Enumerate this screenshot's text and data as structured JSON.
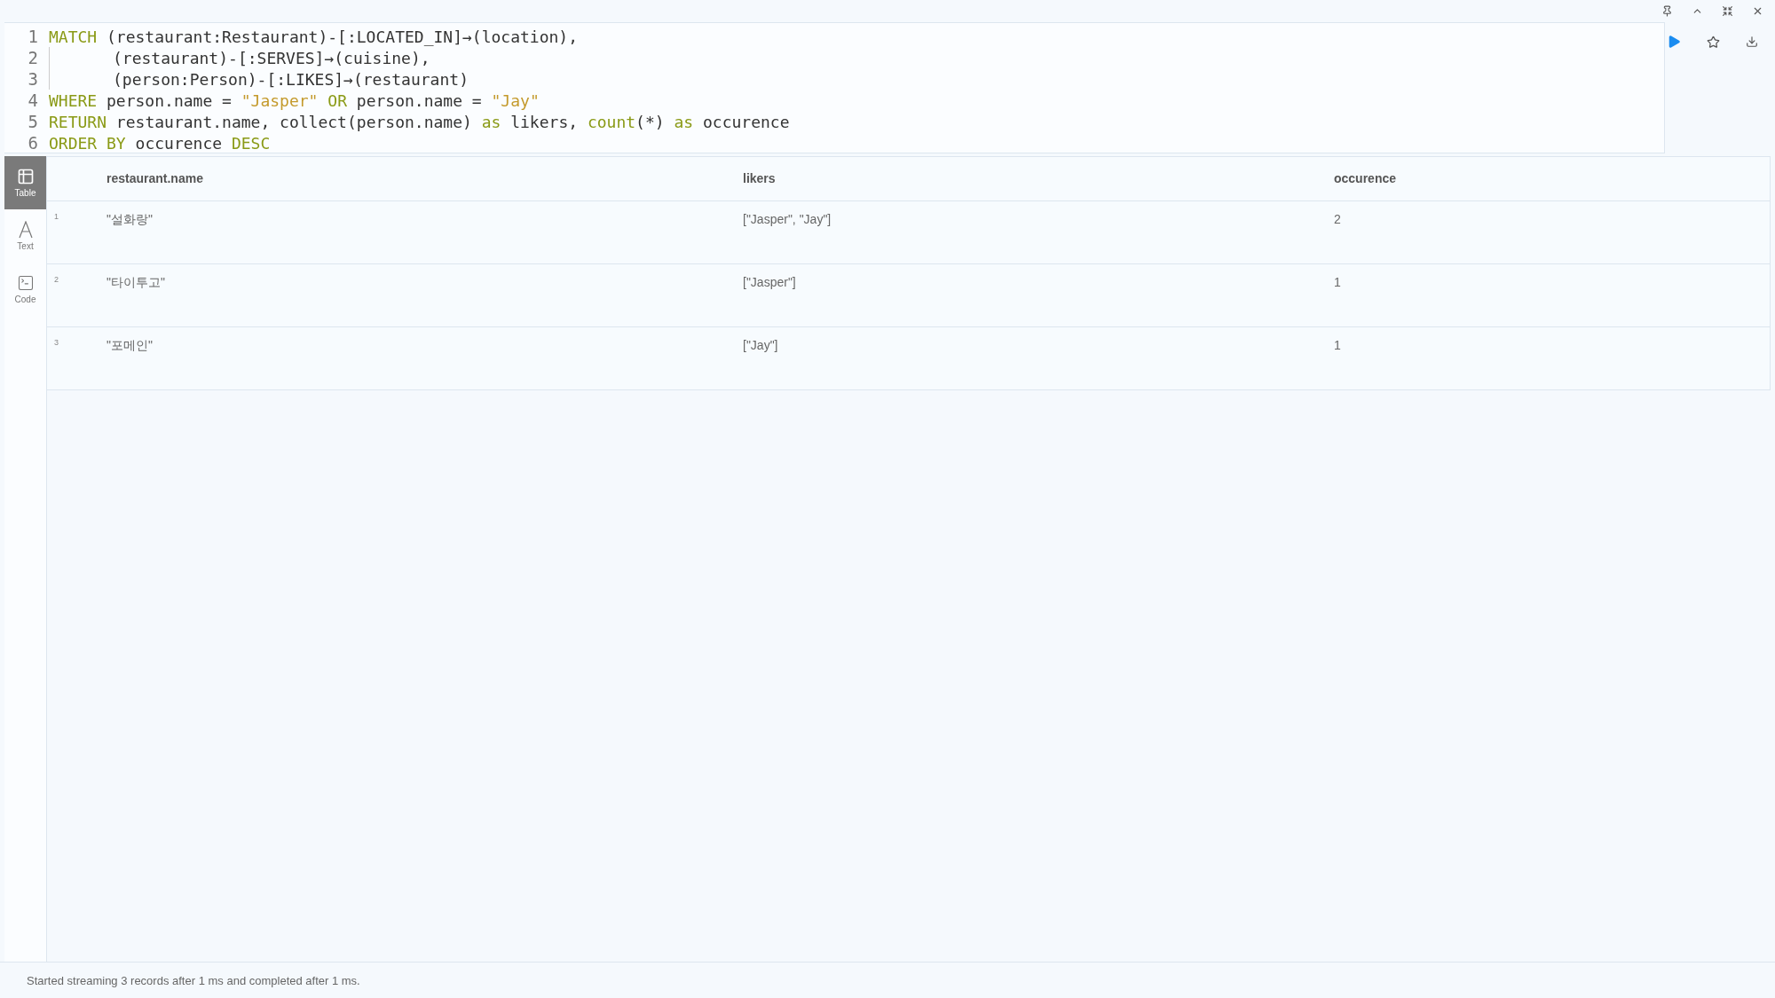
{
  "frame_controls": [
    {
      "kind": "pin"
    },
    {
      "kind": "up"
    },
    {
      "kind": "shrink"
    },
    {
      "kind": "close"
    }
  ],
  "editor": {
    "lines": [
      {
        "number": "1",
        "continuation": false,
        "tokens": [
          {
            "kind": "keyword",
            "text": "MATCH"
          },
          {
            "kind": "plain",
            "text": " (restaurant:Restaurant)-[:LOCATED_IN]→(location),"
          }
        ]
      },
      {
        "number": "2",
        "continuation": true,
        "tokens": [
          {
            "kind": "plain",
            "text": "(restaurant)-[:SERVES]→(cuisine),"
          }
        ]
      },
      {
        "number": "3",
        "continuation": true,
        "tokens": [
          {
            "kind": "plain",
            "text": "(person:Person)-[:LIKES]→(restaurant)"
          }
        ]
      },
      {
        "number": "4",
        "continuation": false,
        "tokens": [
          {
            "kind": "keyword",
            "text": "WHERE"
          },
          {
            "kind": "plain",
            "text": " person.name = "
          },
          {
            "kind": "string",
            "text": "\"Jasper\""
          },
          {
            "kind": "keyword",
            "text": " OR"
          },
          {
            "kind": "plain",
            "text": " person.name = "
          },
          {
            "kind": "string",
            "text": "\"Jay\""
          }
        ]
      },
      {
        "number": "5",
        "continuation": false,
        "tokens": [
          {
            "kind": "keyword",
            "text": "RETURN"
          },
          {
            "kind": "plain",
            "text": " restaurant.name, collect(person.name) "
          },
          {
            "kind": "keyword",
            "text": "as"
          },
          {
            "kind": "plain",
            "text": " likers, "
          },
          {
            "kind": "keyword",
            "text": "count"
          },
          {
            "kind": "plain",
            "text": "(*) "
          },
          {
            "kind": "keyword",
            "text": "as"
          },
          {
            "kind": "plain",
            "text": " occurence"
          }
        ]
      },
      {
        "number": "6",
        "continuation": false,
        "tokens": [
          {
            "kind": "keyword",
            "text": "ORDER BY"
          },
          {
            "kind": "plain",
            "text": " occurence "
          },
          {
            "kind": "keyword",
            "text": "DESC"
          }
        ]
      }
    ]
  },
  "editor_actions": [
    {
      "kind": "run"
    },
    {
      "kind": "favorite"
    },
    {
      "kind": "download"
    }
  ],
  "view_tabs": [
    {
      "kind": "table",
      "label": "Table",
      "selected": true
    },
    {
      "kind": "text",
      "label": "Text",
      "selected": false
    },
    {
      "kind": "code",
      "label": "Code",
      "selected": false
    }
  ],
  "table": {
    "columns": [
      "restaurant.name",
      "likers",
      "occurence"
    ],
    "rows": [
      {
        "number": "1",
        "cells": [
          "\"설화랑\"",
          "[\"Jasper\", \"Jay\"]",
          "2"
        ]
      },
      {
        "number": "2",
        "cells": [
          "\"타이투고\"",
          "[\"Jasper\"]",
          "1"
        ]
      },
      {
        "number": "3",
        "cells": [
          "\"포메인\"",
          "[\"Jay\"]",
          "1"
        ]
      }
    ]
  },
  "status_bar": "Started streaming 3 records after 1 ms and completed after 1 ms."
}
